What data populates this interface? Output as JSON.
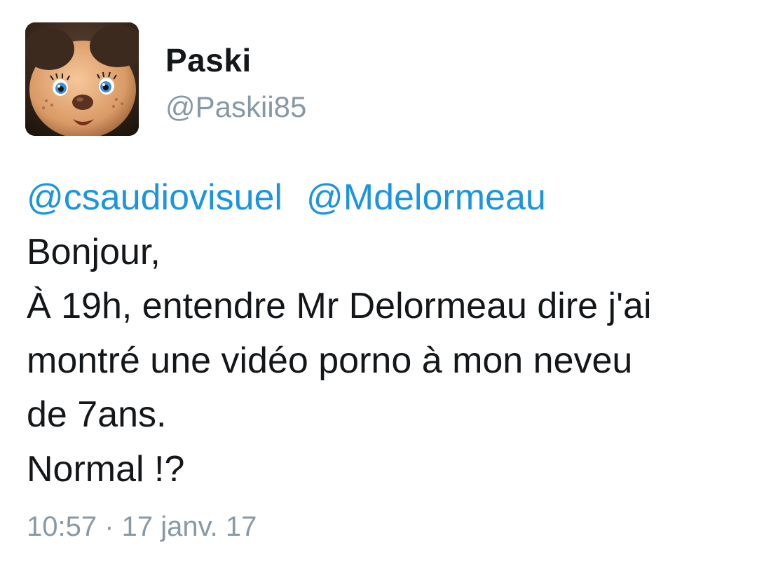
{
  "author": {
    "display_name": "Paski",
    "handle": "@Paskii85",
    "avatar_icon": "avatar-doll-face"
  },
  "tweet": {
    "mentions": [
      "@csaudiovisuel",
      "@Mdelormeau"
    ],
    "lines": [
      "Bonjour,",
      "À 19h, entendre Mr Delormeau dire j'ai",
      "montré une vidéo porno à mon neveu",
      "de 7ans.",
      "Normal !?"
    ]
  },
  "meta": {
    "timestamp": "10:57 · 17 janv. 17"
  },
  "colors": {
    "link": "#1b95e0",
    "text": "#14171a",
    "muted": "#8899a6"
  }
}
